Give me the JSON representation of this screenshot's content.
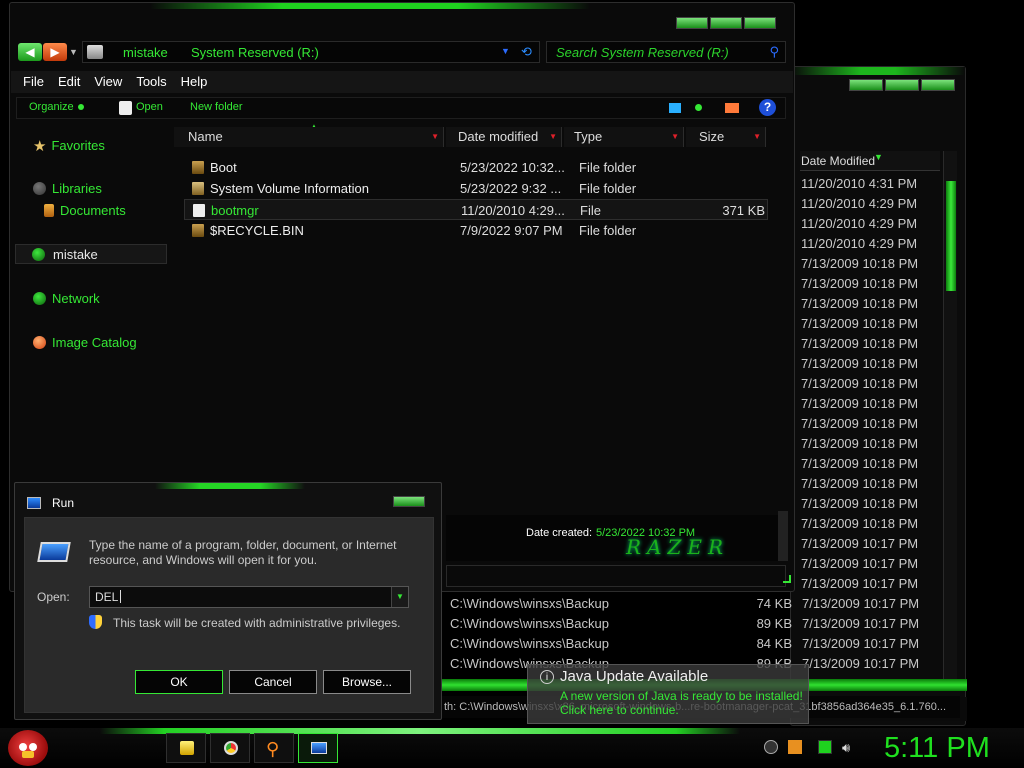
{
  "explorer": {
    "address_parts": [
      "mistake",
      "System Reserved (R:)"
    ],
    "search_placeholder": "Search System Reserved (R:)",
    "menu": [
      "File",
      "Edit",
      "View",
      "Tools",
      "Help"
    ],
    "toolbar": {
      "organize": "Organize",
      "open": "Open",
      "new_folder": "New folder"
    },
    "nav": {
      "favorites": "Favorites",
      "libraries": "Libraries",
      "documents": "Documents",
      "computer": "mistake",
      "network": "Network",
      "image_catalog": "Image Catalog"
    },
    "columns": {
      "name": "Name",
      "date_modified": "Date modified",
      "type": "Type",
      "size": "Size"
    },
    "files": [
      {
        "name": "Boot",
        "date": "5/23/2022 10:32...",
        "type": "File folder",
        "size": ""
      },
      {
        "name": "System Volume Information",
        "date": "5/23/2022 9:32 ...",
        "type": "File folder",
        "size": ""
      },
      {
        "name": "bootmgr",
        "date": "11/20/2010 4:29...",
        "type": "File",
        "size": "371 KB"
      },
      {
        "name": "$RECYCLE.BIN",
        "date": "7/9/2022 9:07 PM",
        "type": "File folder",
        "size": ""
      }
    ],
    "details": {
      "label": "Date created:",
      "value": "5/23/2022 10:32 PM",
      "logo_text": "RAZER"
    }
  },
  "back_window": {
    "column_header": "Date Modified",
    "dates": [
      "11/20/2010 4:31 PM",
      "11/20/2010 4:29 PM",
      "11/20/2010 4:29 PM",
      "11/20/2010 4:29 PM",
      "7/13/2009 10:18 PM",
      "7/13/2009 10:18 PM",
      "7/13/2009 10:18 PM",
      "7/13/2009 10:18 PM",
      "7/13/2009 10:18 PM",
      "7/13/2009 10:18 PM",
      "7/13/2009 10:18 PM",
      "7/13/2009 10:18 PM",
      "7/13/2009 10:18 PM",
      "7/13/2009 10:18 PM",
      "7/13/2009 10:18 PM",
      "7/13/2009 10:18 PM",
      "7/13/2009 10:18 PM",
      "7/13/2009 10:18 PM",
      "7/13/2009 10:17 PM",
      "7/13/2009 10:17 PM",
      "7/13/2009 10:17 PM"
    ],
    "bottom_rows": [
      {
        "path": "C:\\Windows\\winsxs\\Backup",
        "size": "74 KB",
        "date": "7/13/2009 10:17 PM"
      },
      {
        "path": "C:\\Windows\\winsxs\\Backup",
        "size": "89 KB",
        "date": "7/13/2009 10:17 PM"
      },
      {
        "path": "C:\\Windows\\winsxs\\Backup",
        "size": "84 KB",
        "date": "7/13/2009 10:17 PM"
      },
      {
        "path": "C:\\Windows\\winsxs\\Backup",
        "size": "89 KB",
        "date": "7/13/2009 10:17 PM"
      }
    ],
    "status_path": "th: C:\\Windows\\winsxs\\x86_microsoft-windows-b...re-bootmanager-pcat_31bf3856ad364e35_6.1.760..."
  },
  "run_dialog": {
    "title": "Run",
    "description": "Type the name of a program, folder, document, or Internet resource, and Windows will open it for you.",
    "open_label": "Open:",
    "input_value": "DEL",
    "admin_note": "This task will be created with administrative privileges.",
    "ok": "OK",
    "cancel": "Cancel",
    "browse": "Browse..."
  },
  "java_toast": {
    "title": "Java Update Available",
    "line1": "A new version of Java is ready to be installed!",
    "line2": "Click here to continue."
  },
  "taskbar": {
    "clock": "5:11 PM"
  },
  "colors": {
    "accent_green": "#35e835",
    "background": "#000000"
  }
}
